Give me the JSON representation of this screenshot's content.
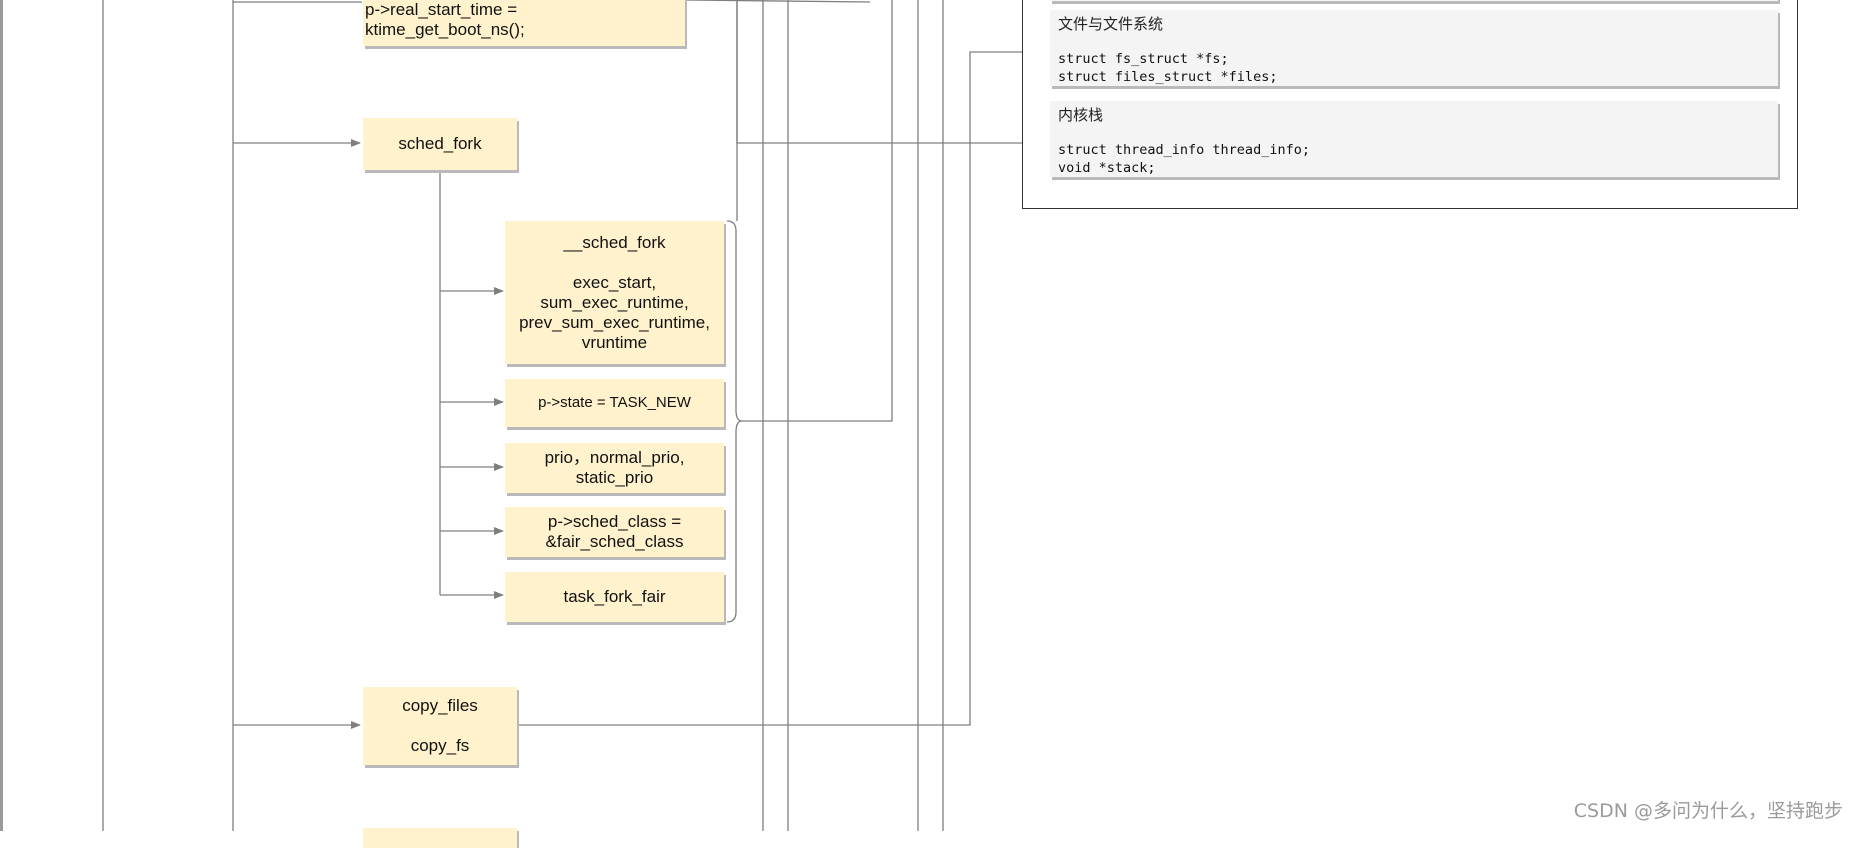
{
  "nodes": {
    "real_start": {
      "line1": "p->real_start_time =",
      "line2": "ktime_get_boot_ns();"
    },
    "sched_fork": {
      "label": "sched_fork"
    },
    "__sched_fork": {
      "title": "__sched_fork",
      "lines": [
        "exec_start,",
        "sum_exec_runtime,",
        "prev_sum_exec_runtime,",
        "vruntime"
      ]
    },
    "state": {
      "label": "p->state = TASK_NEW"
    },
    "prio": {
      "line1": "prio，normal_prio,",
      "line2": "static_prio"
    },
    "sched_class": {
      "line1": "p->sched_class =",
      "line2": "&fair_sched_class"
    },
    "task_fork_fair": {
      "label": "task_fork_fair"
    },
    "copy_files": {
      "line1": "copy_files",
      "line2": "copy_fs"
    }
  },
  "panel": {
    "fs_card": {
      "title": "文件与文件系统",
      "code1": "struct fs_struct *fs;",
      "code2": "struct files_struct *files;"
    },
    "stack_card": {
      "title": "内核栈",
      "code1": "struct thread_info thread_info;",
      "code2": "void *stack;"
    }
  },
  "watermark": "CSDN @多问为什么，坚持跑步",
  "colors": {
    "node_fill": "#fff2cc",
    "card_fill": "#f4f4f4",
    "line": "#7f7f7f"
  }
}
